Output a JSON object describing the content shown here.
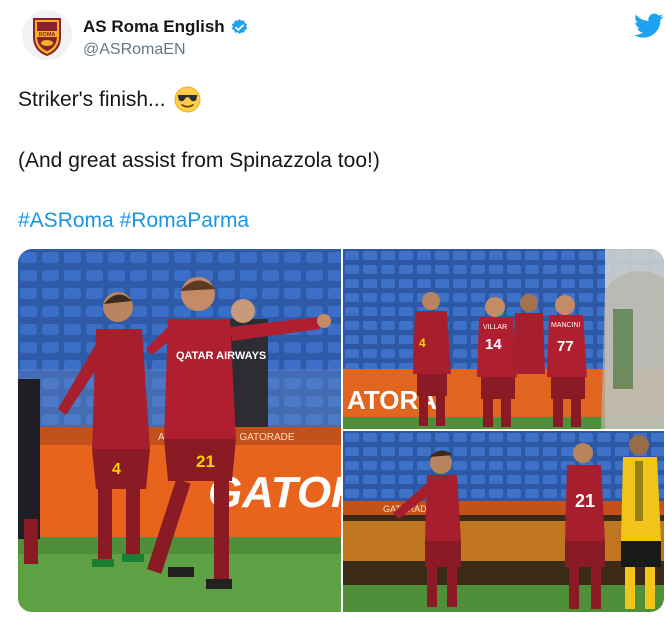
{
  "account": {
    "name": "AS Roma English",
    "handle": "@ASRomaEN",
    "verified_icon": "verified-badge-icon",
    "crest_text": "ROMA",
    "brand_color": "#1da1f2"
  },
  "tweet": {
    "line1": "Striker's finish...",
    "line1_emoji": "sunglasses-emoji",
    "line2": "(And great assist from Spinazzola too!)",
    "hashtags": [
      "#ASRoma",
      "#RomaParma"
    ]
  },
  "photos": {
    "p1": {
      "sponsor": "QATAR AIRWAYS",
      "number_left": "4",
      "number_right": "21",
      "board": "GATOR",
      "board_strip": "ADE GATORADE GATORADE"
    },
    "p2": {
      "board": "ATORA",
      "number_a": "4",
      "number_b": "14",
      "number_c": "77",
      "name_b": "VILLAR",
      "name_c": "MANCINI"
    },
    "p3": {
      "number": "21",
      "number_yellow": "",
      "board_strip": "GATORADE"
    }
  }
}
